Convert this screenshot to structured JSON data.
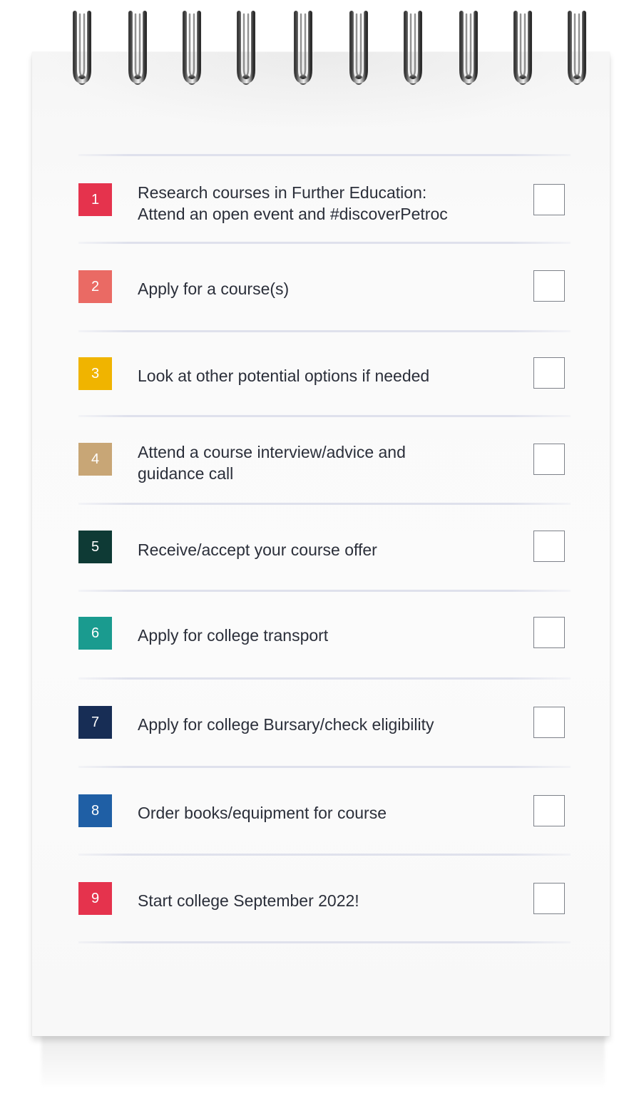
{
  "tasks": [
    {
      "num": "1",
      "text": "Research courses in Further Education:\nAttend an open event and #discoverPetroc",
      "color": "#e5334d"
    },
    {
      "num": "2",
      "text": "Apply for a course(s)",
      "color": "#ea6a64"
    },
    {
      "num": "3",
      "text": "Look at other potential options if needed",
      "color": "#f0b400"
    },
    {
      "num": "4",
      "text": "Attend a course interview/advice and\nguidance call",
      "color": "#c8a676"
    },
    {
      "num": "5",
      "text": "Receive/accept your course offer",
      "color": "#0e3a35"
    },
    {
      "num": "6",
      "text": "Apply for college transport",
      "color": "#1a9b8f"
    },
    {
      "num": "7",
      "text": "Apply for college Bursary/check eligibility",
      "color": "#172d55"
    },
    {
      "num": "8",
      "text": "Order books/equipment for course",
      "color": "#1f5fa5"
    },
    {
      "num": "9",
      "text": "Start college September 2022!",
      "color": "#e5334d"
    }
  ],
  "icons": {
    "spiral_ring": "spiral-ring-icon",
    "checkbox": "checkbox"
  },
  "colors": {
    "text": "#2b2f3a",
    "rule": "#dfe1ec",
    "checkbox_border": "#7d8189"
  }
}
